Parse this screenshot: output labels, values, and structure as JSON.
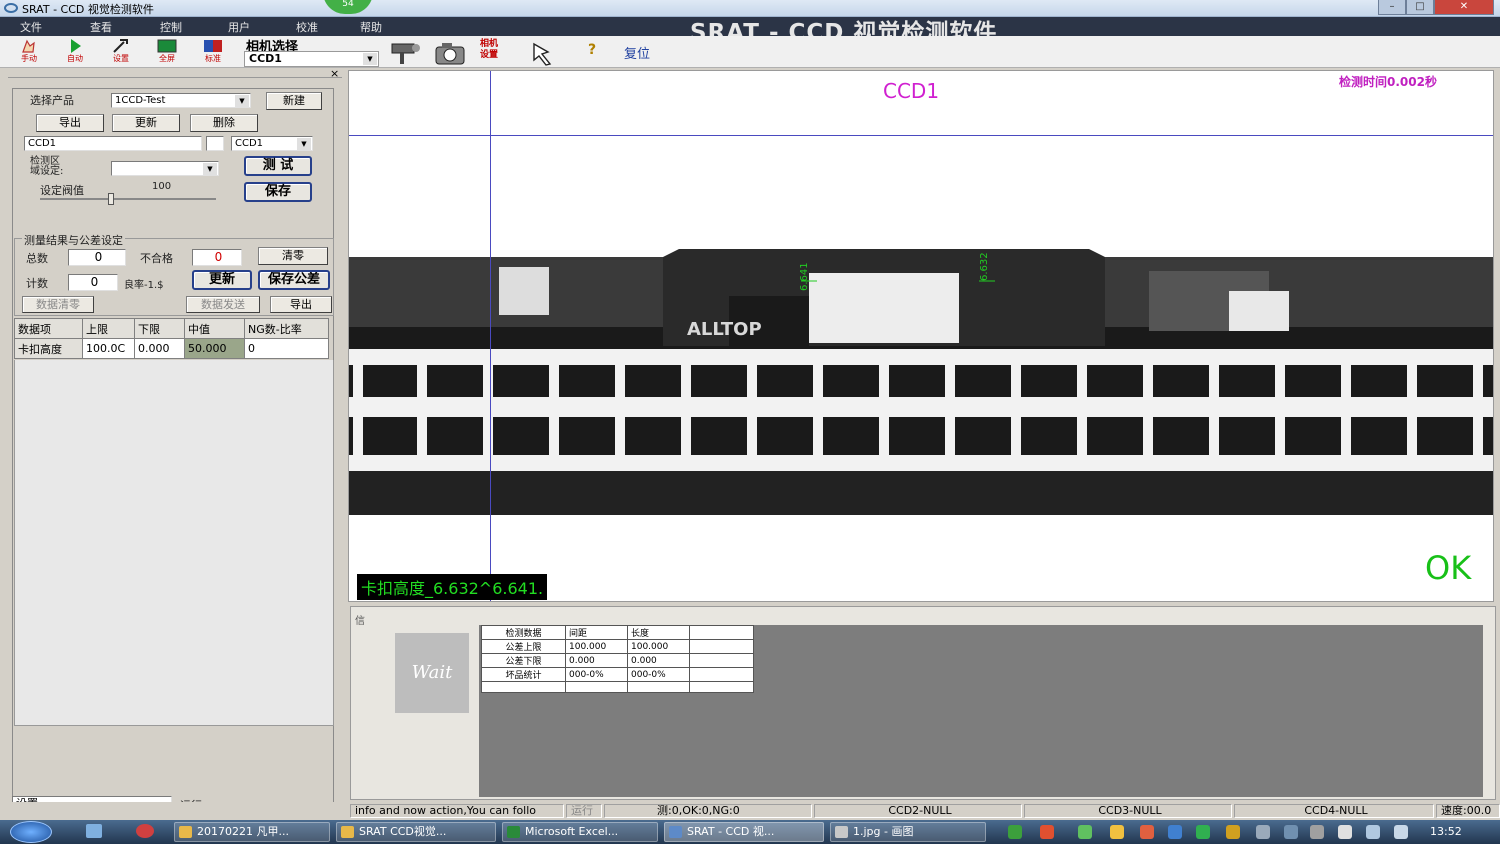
{
  "window": {
    "title": "SRAT - CCD 视觉检测软件",
    "big_title": "SRAT - CCD 视觉检测软件",
    "badge": "54"
  },
  "menu": [
    "文件",
    "查看",
    "控制",
    "用户",
    "校准",
    "帮助"
  ],
  "toolbar": {
    "buttons": [
      {
        "label": "手动",
        "icon": "hand-pointer-icon"
      },
      {
        "label": "自动",
        "icon": "play-icon"
      },
      {
        "label": "设置",
        "icon": "tools-icon"
      },
      {
        "label": "全屏",
        "icon": "fullscreen-icon"
      },
      {
        "label": "标准",
        "icon": "standard-icon"
      }
    ],
    "camera_select_label": "相机选择",
    "camera_select_value": "CCD1",
    "camera_settings_label": "相机\n设置",
    "reset_label": "复位"
  },
  "left_panel": {
    "product_label": "选择产品",
    "product_value": "1CCD-Test",
    "new_btn": "新建",
    "export_btn": "导出",
    "update_btn": "更新",
    "delete_btn": "删除",
    "ccd_field": "CCD1",
    "ccd_combo": "CCD1",
    "detect_area_label": "检测区\n域设定:",
    "test_btn": "测 试",
    "save_btn": "保存",
    "threshold_label": "设定阀值",
    "threshold_value": "100",
    "group_title": "测量结果与公差设定",
    "total_label": "总数",
    "total_value": "0",
    "ng_label": "不合格",
    "ng_value": "0",
    "clear_btn": "清零",
    "count_label": "计数",
    "count_value": "0",
    "yield_label": "良率-1.$",
    "update2_btn": "更新",
    "save_tol_btn": "保存公差",
    "data_clear_btn": "数据清零",
    "data_send_btn": "数据发送",
    "export2_btn": "导出",
    "grid": {
      "headers": [
        "数据项",
        "上限",
        "下限",
        "中值",
        "NG数-比率"
      ],
      "row": [
        "卡扣高度",
        "100.0C",
        "0.000",
        "50.000",
        "0"
      ]
    },
    "mode_label": "设置",
    "mode_value": "运行"
  },
  "camera_view": {
    "title": "CCD1",
    "detect_time": "检测时间0.002秒",
    "result": "OK",
    "measurement": "卡扣高度_6.632^6.641.",
    "label_left": "6.641",
    "label_right": "6.632",
    "brand": "ALLTOP"
  },
  "results": {
    "tag": "信",
    "wait": "Wait",
    "table": [
      [
        "检测数据",
        "间距",
        "长度",
        ""
      ],
      [
        "公差上限",
        "100.000",
        "100.000",
        ""
      ],
      [
        "公差下限",
        "0.000",
        "0.000",
        ""
      ],
      [
        "坏品统计",
        "000-0%",
        "000-0%",
        ""
      ],
      [
        "",
        "",
        "",
        ""
      ]
    ]
  },
  "statusbar": {
    "info": "info and now action,You can follo",
    "running": "运行",
    "ccd1": "测:0,OK:0,NG:0",
    "ccd2": "CCD2-NULL",
    "ccd3": "CCD3-NULL",
    "ccd4": "CCD4-NULL",
    "speed": "速度:00.0"
  },
  "taskbar": {
    "tasks": [
      "20170221 凡甲...",
      "SRAT CCD视觉...",
      "Microsoft Excel...",
      "SRAT - CCD 视...",
      "1.jpg - 画图"
    ],
    "clock": "13:52"
  }
}
